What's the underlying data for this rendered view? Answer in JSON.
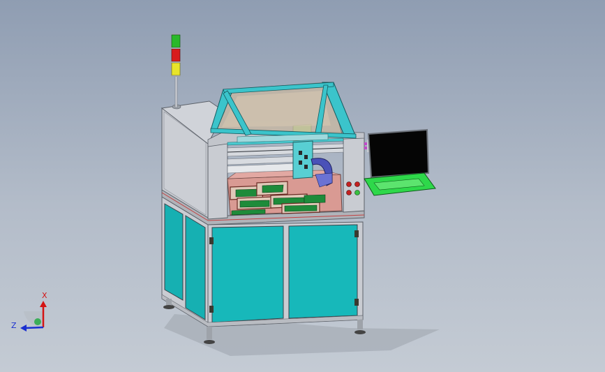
{
  "viewport": {
    "background_top": "#8f9db2",
    "background_bottom": "#c4cbd4"
  },
  "triad": {
    "x_label": "X",
    "z_label": "Z",
    "x_color": "#d41414",
    "z_color": "#1a2fd0"
  },
  "colors": {
    "frame": "#c9ccd2",
    "panel": "#16b6b8",
    "glass": "#c9b8a0",
    "gantry": "#49c9cf",
    "bed": "#d99a93",
    "pcb": "#1e8b3a",
    "monitor_screen": "#050505",
    "keyboard_tray": "#2ed84a"
  },
  "signal_tower": {
    "levels": [
      "green",
      "red",
      "yellow"
    ]
  }
}
